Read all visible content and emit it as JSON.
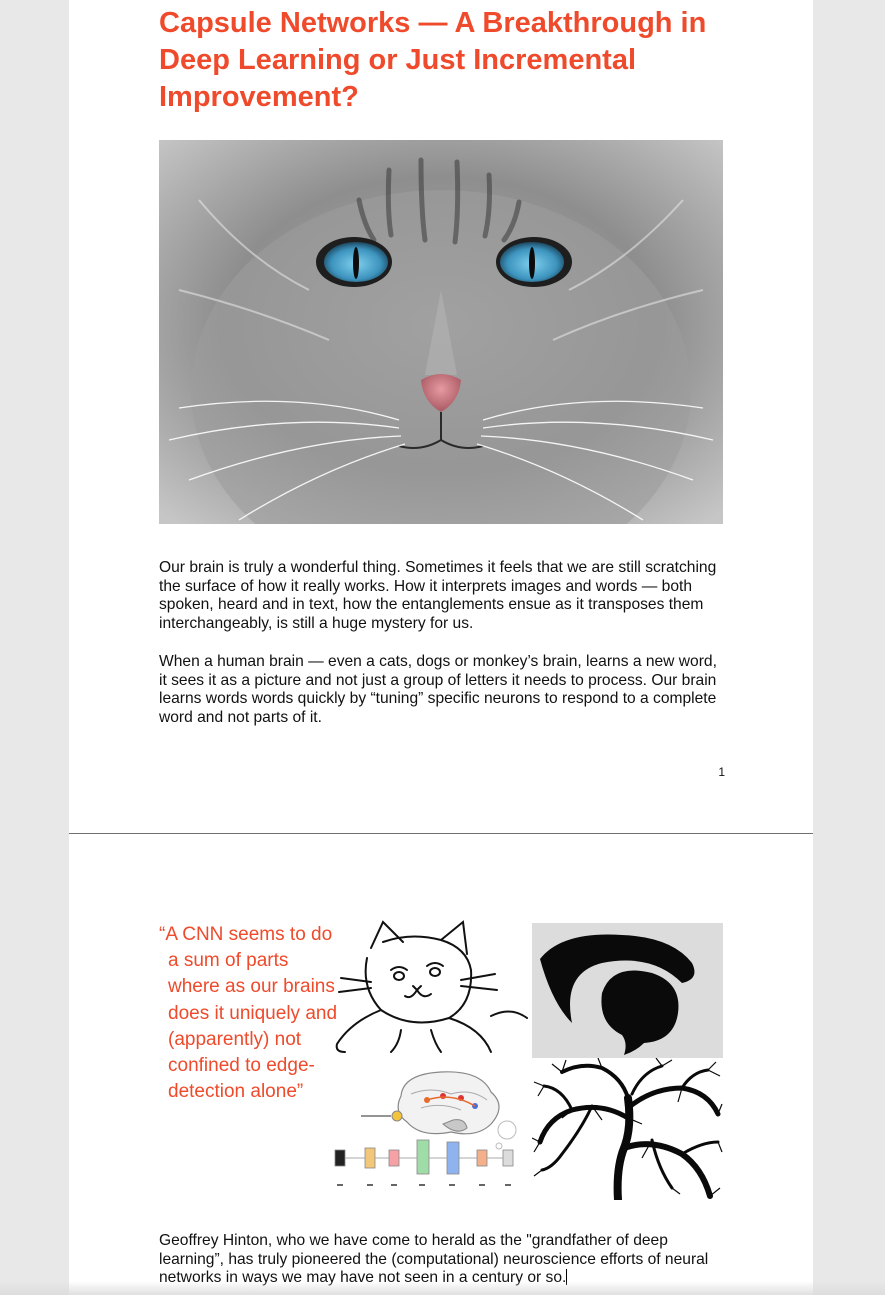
{
  "document": {
    "title": "Capsule Networks — A Breakthrough in Deep Learning or Just Incremental Improvement?",
    "paragraphs": [
      "Our brain is truly a wonderful thing. Sometimes it feels that we are still scratching the surface of how it really works. How it interprets images and words — both spoken, heard and in text, how the entanglements ensue as it transposes them interchangeably, is still a huge mystery for us.",
      "When a human brain — even a cats, dogs or monkey’s brain, learns a new word, it sees it as a picture and not just a group of letters it needs to process. Our brain learns words words quickly by “tuning” specific neurons to respond to a complete word and not parts of it.",
      "Geoffrey Hinton, who we have come to herald as the \"grandfather of deep learning”, has truly pioneered the (computational) neuroscience efforts of neural networks in ways we may have not seen in a century or so."
    ],
    "page_number": "1",
    "quote": "“A CNN seems to do a sum of parts where as our brains does it uniquely and (apparently) not confined to edge-detection alone”"
  },
  "colors": {
    "accent": "#ee4a2b",
    "page_background": "#ffffff",
    "canvas_background": "#e8e8e8",
    "cat_eye": "#4aa3c8",
    "cat_nose": "#d9808a"
  },
  "images": [
    {
      "name": "cat-photo",
      "description_icon": "grayscale-cat-with-blue-eyes"
    },
    {
      "name": "cat-line-drawing",
      "description_icon": "cat-sketch"
    },
    {
      "name": "blob-shape",
      "description_icon": "black-curved-shape"
    },
    {
      "name": "cnn-brain-diagram",
      "description_icon": "brain-neural-pipeline"
    },
    {
      "name": "tree-brain",
      "description_icon": "tree-shaped-brain"
    }
  ]
}
